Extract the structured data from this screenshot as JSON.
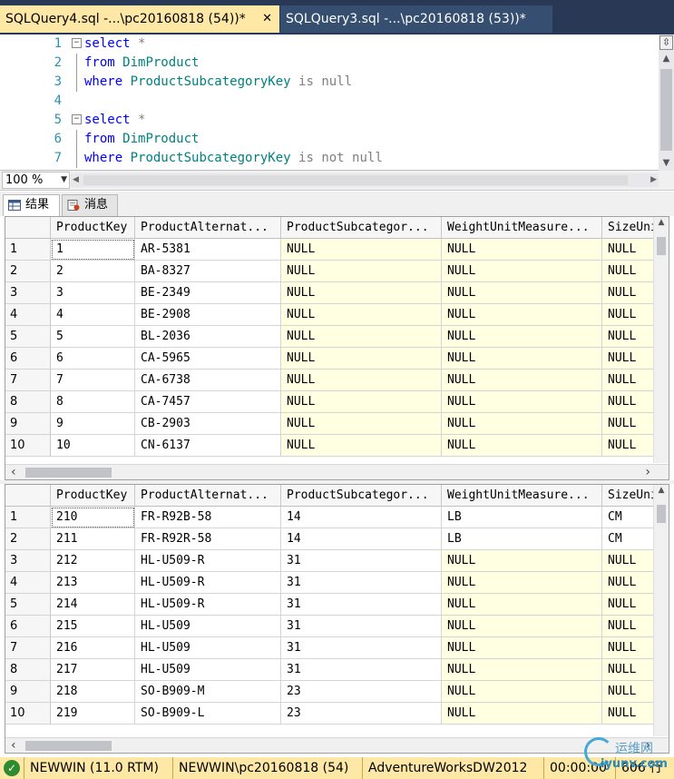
{
  "tabs": [
    {
      "label": "SQLQuery4.sql -...\\pc20160818 (54))*",
      "close": "✕"
    },
    {
      "label": "SQLQuery3.sql -...\\pc20160818 (53))*"
    }
  ],
  "editor": {
    "lines": [
      {
        "num": "1",
        "fold": "−",
        "tokens": [
          {
            "t": "select",
            "c": "kw"
          },
          {
            "t": " *",
            "c": "gr"
          }
        ]
      },
      {
        "num": "2",
        "tokens": [
          {
            "t": "from",
            "c": "kw"
          },
          {
            "t": " ",
            "c": ""
          },
          {
            "t": "DimProduct",
            "c": "id"
          }
        ]
      },
      {
        "num": "3",
        "tokens": [
          {
            "t": "where",
            "c": "kw"
          },
          {
            "t": " ",
            "c": ""
          },
          {
            "t": "ProductSubcategoryKey",
            "c": "id"
          },
          {
            "t": " is null",
            "c": "gr"
          }
        ]
      },
      {
        "num": "4",
        "tokens": []
      },
      {
        "num": "5",
        "fold": "−",
        "tokens": [
          {
            "t": "select",
            "c": "kw"
          },
          {
            "t": " *",
            "c": "gr"
          }
        ]
      },
      {
        "num": "6",
        "tokens": [
          {
            "t": "from",
            "c": "kw"
          },
          {
            "t": " ",
            "c": ""
          },
          {
            "t": "DimProduct",
            "c": "id"
          }
        ]
      },
      {
        "num": "7",
        "tokens": [
          {
            "t": "where",
            "c": "kw"
          },
          {
            "t": " ",
            "c": ""
          },
          {
            "t": "ProductSubcategoryKey",
            "c": "id"
          },
          {
            "t": " is not null",
            "c": "gr"
          }
        ]
      }
    ]
  },
  "zoom": {
    "value": "100 %"
  },
  "result_tabs": [
    {
      "label": "结果"
    },
    {
      "label": "消息"
    }
  ],
  "grid1": {
    "columns": [
      "ProductKey",
      "ProductAlternat...",
      "ProductSubcategor...",
      "WeightUnitMeasure...",
      "SizeUni"
    ],
    "rows": [
      [
        "1",
        "1",
        "AR-5381",
        "NULL",
        "NULL",
        "NULL"
      ],
      [
        "2",
        "2",
        "BA-8327",
        "NULL",
        "NULL",
        "NULL"
      ],
      [
        "3",
        "3",
        "BE-2349",
        "NULL",
        "NULL",
        "NULL"
      ],
      [
        "4",
        "4",
        "BE-2908",
        "NULL",
        "NULL",
        "NULL"
      ],
      [
        "5",
        "5",
        "BL-2036",
        "NULL",
        "NULL",
        "NULL"
      ],
      [
        "6",
        "6",
        "CA-5965",
        "NULL",
        "NULL",
        "NULL"
      ],
      [
        "7",
        "7",
        "CA-6738",
        "NULL",
        "NULL",
        "NULL"
      ],
      [
        "8",
        "8",
        "CA-7457",
        "NULL",
        "NULL",
        "NULL"
      ],
      [
        "9",
        "9",
        "CB-2903",
        "NULL",
        "NULL",
        "NULL"
      ],
      [
        "10",
        "10",
        "CN-6137",
        "NULL",
        "NULL",
        "NULL"
      ]
    ]
  },
  "grid2": {
    "columns": [
      "ProductKey",
      "ProductAlternat...",
      "ProductSubcategor...",
      "WeightUnitMeasure...",
      "SizeUni"
    ],
    "rows": [
      [
        "1",
        "210",
        "FR-R92B-58",
        "14",
        "LB",
        "CM"
      ],
      [
        "2",
        "211",
        "FR-R92R-58",
        "14",
        "LB",
        "CM"
      ],
      [
        "3",
        "212",
        "HL-U509-R",
        "31",
        "NULL",
        "NULL"
      ],
      [
        "4",
        "213",
        "HL-U509-R",
        "31",
        "NULL",
        "NULL"
      ],
      [
        "5",
        "214",
        "HL-U509-R",
        "31",
        "NULL",
        "NULL"
      ],
      [
        "6",
        "215",
        "HL-U509",
        "31",
        "NULL",
        "NULL"
      ],
      [
        "7",
        "216",
        "HL-U509",
        "31",
        "NULL",
        "NULL"
      ],
      [
        "8",
        "217",
        "HL-U509",
        "31",
        "NULL",
        "NULL"
      ],
      [
        "9",
        "218",
        "SO-B909-M",
        "23",
        "NULL",
        "NULL"
      ],
      [
        "10",
        "219",
        "SO-B909-L",
        "23",
        "NULL",
        "NULL"
      ]
    ]
  },
  "status": {
    "icon": "connected-icon",
    "server": "NEWWIN (11.0 RTM)",
    "login": "NEWWIN\\pc20160818 (54)",
    "database": "AdventureWorksDW2012",
    "elapsed": "00:00:00",
    "rows": "606 行"
  },
  "watermark": {
    "line1": "运维网",
    "line2": "iyunv.com"
  },
  "colors": {
    "tab_active": "#ffe8a6",
    "tab_bar": "#293955",
    "keyword": "#0000ff",
    "identifier": "#008080",
    "null_cell": "#ffffe1",
    "line_number": "#2b91af"
  }
}
